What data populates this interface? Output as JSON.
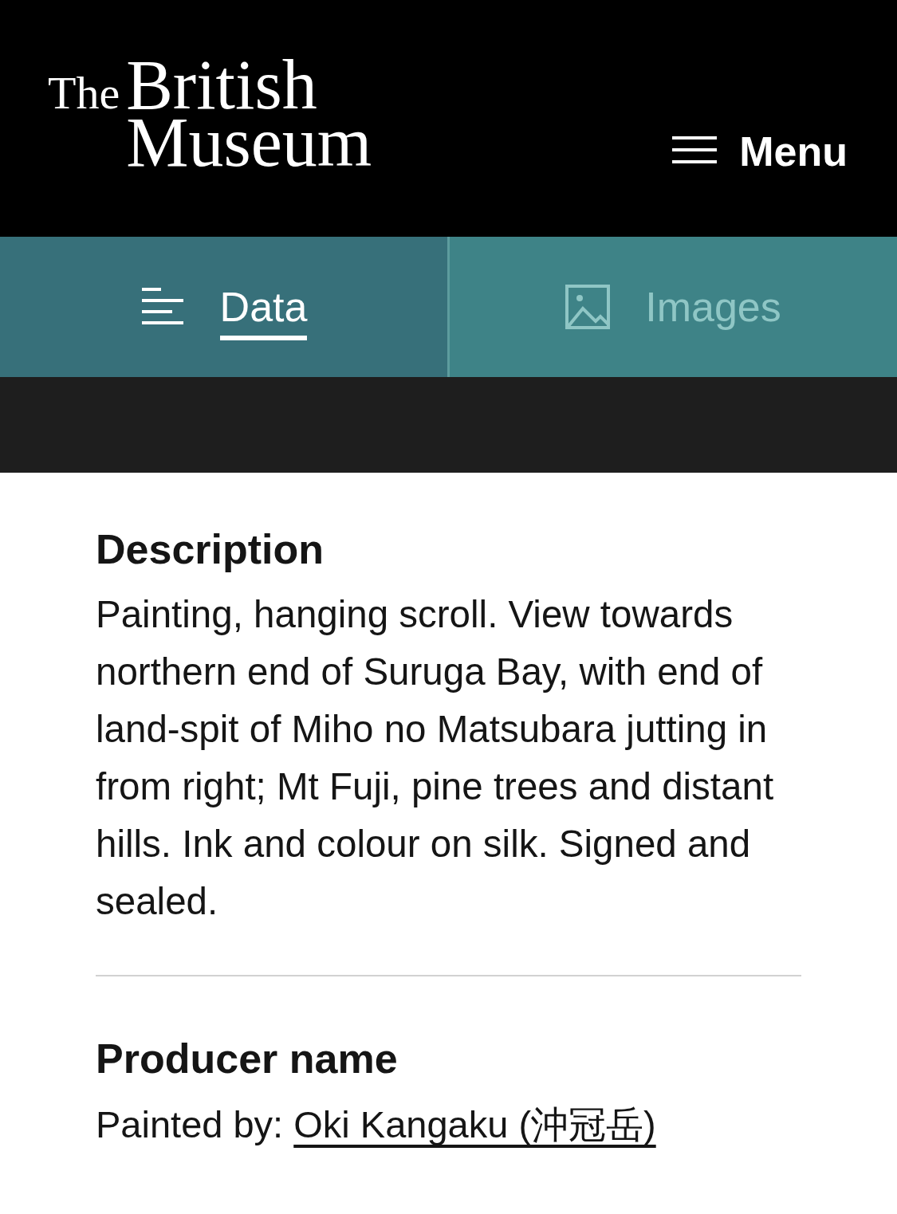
{
  "header": {
    "logo": {
      "small_word": "The",
      "line_1": "British",
      "line_2": "Museum"
    },
    "menu_button": {
      "label": "Menu"
    }
  },
  "tabs": [
    {
      "kind": "data",
      "label": "Data",
      "selected": true
    },
    {
      "kind": "images",
      "label": "Images",
      "selected": false
    }
  ],
  "sections": [
    {
      "kind": "paragraph",
      "heading": "Description",
      "text": "Painting, hanging scroll. View towards northern end of Suruga Bay, with end of land-spit of Miho no Matsubara jutting in from right; Mt Fuji, pine trees and distant hills. Ink and colour on silk. Signed and sealed."
    },
    {
      "kind": "attribution",
      "heading": "Producer name",
      "prefix": "Painted by:",
      "link": "Oki Kangaku (沖冠岳)"
    }
  ]
}
